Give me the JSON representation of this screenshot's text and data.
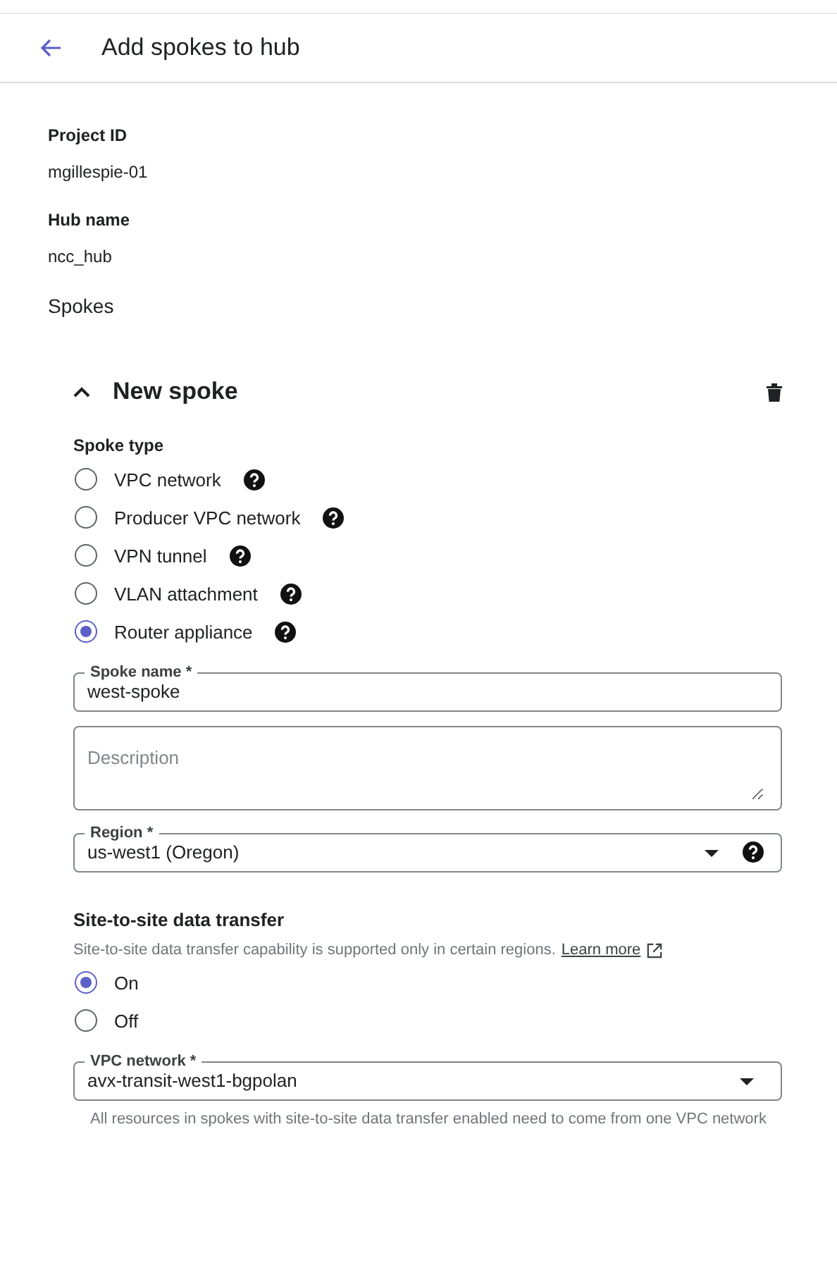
{
  "header": {
    "title": "Add spokes to hub"
  },
  "details": [
    {
      "label": "Project ID",
      "value": "mgillespie-01"
    },
    {
      "label": "Hub name",
      "value": "ncc_hub"
    }
  ],
  "spokes_heading": "Spokes",
  "spoke": {
    "title": "New spoke",
    "expanded": true,
    "spoke_type": {
      "label": "Spoke type",
      "options": [
        {
          "label": "VPC network",
          "selected": false
        },
        {
          "label": "Producer VPC network",
          "selected": false
        },
        {
          "label": "VPN tunnel",
          "selected": false
        },
        {
          "label": "VLAN attachment",
          "selected": false
        },
        {
          "label": "Router appliance",
          "selected": true
        }
      ]
    },
    "fields": [
      {
        "kind": "text",
        "label": "Spoke name *",
        "value": "west-spoke"
      },
      {
        "kind": "textarea",
        "placeholder": "Description"
      },
      {
        "kind": "select",
        "label": "Region *",
        "value": "us-west1 (Oregon)",
        "help": true
      }
    ],
    "site_to_site": {
      "heading": "Site-to-site data transfer",
      "description": "Site-to-site data transfer capability is supported only in certain regions.",
      "link": "Learn more",
      "options": [
        {
          "label": "On",
          "selected": true
        },
        {
          "label": "Off",
          "selected": false
        }
      ]
    },
    "vpc_field": {
      "kind": "select",
      "label": "VPC network *",
      "value": "avx-transit-west1-bgpolan",
      "hint": "All resources in spokes with site-to-site data transfer enabled need to come from one VPC network"
    }
  }
}
